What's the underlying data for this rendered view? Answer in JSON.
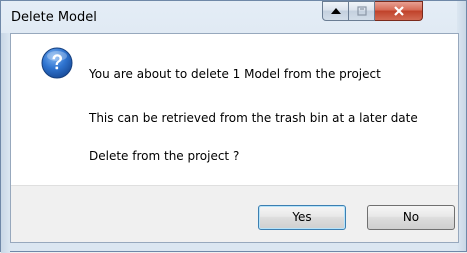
{
  "window": {
    "title": "Delete Model"
  },
  "dialog": {
    "icon": "question-icon",
    "lines": [
      "You are about to delete 1 Model from the project",
      "This can be retrieved from the trash bin at a later date",
      "Delete from the project ?"
    ]
  },
  "buttons": {
    "yes_label": "Yes",
    "no_label": "No"
  },
  "colors": {
    "title_bar": "#dbe6f1",
    "close_button": "#c0422a",
    "question_icon": "#1f63c6",
    "default_button_border": "#3c7fb1"
  }
}
